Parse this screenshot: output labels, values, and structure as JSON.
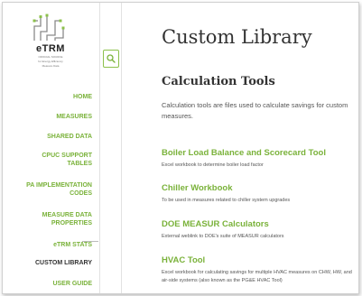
{
  "brand": {
    "name": "eTRM",
    "sub_line1": "OFFICIAL SOURCE",
    "sub_line2": "for Energy Efficiency",
    "sub_line3": "Measure Data"
  },
  "nav": [
    {
      "label": "HOME"
    },
    {
      "label": "MEASURES"
    },
    {
      "label": "SHARED DATA"
    },
    {
      "label": "CPUC SUPPORT",
      "label2": "TABLES"
    },
    {
      "label": "PA IMPLEMENTATION",
      "label2": "CODES"
    },
    {
      "label": "MEASURE DATA",
      "label2": "PROPERTIES"
    },
    {
      "label": "eTRM STATS"
    },
    {
      "label": "CUSTOM LIBRARY"
    },
    {
      "label": "USER GUIDE"
    }
  ],
  "page_title": "Custom Library",
  "section_title": "Calculation Tools",
  "intro": "Calculation tools are files used to calculate savings for custom measures.",
  "tools": [
    {
      "title": "Boiler Load Balance and Scorecard Tool",
      "desc": "Excel workbook to determine boiler load factor"
    },
    {
      "title": "Chiller Workbook",
      "desc": "To be used in measures related to chiller system upgrades"
    },
    {
      "title": "DOE MEASUR Calculators",
      "desc": "External weblink to DOE's suite of MEASUR calculators"
    },
    {
      "title": "HVAC Tool",
      "desc": "Excel workbook for calculating savings for multiple HVAC measures on CHW, HW, and air-side systems (also known as the PG&E HVAC Tool)"
    }
  ],
  "colors": {
    "accent": "#7ab23a",
    "active_nav": "#333333"
  },
  "icons": {
    "search": "search-icon",
    "logo": "etrm-logo-icon"
  }
}
